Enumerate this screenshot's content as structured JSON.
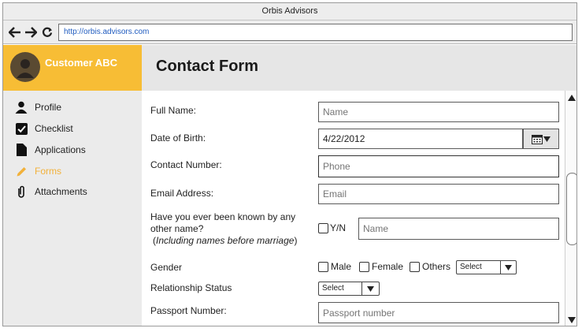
{
  "window": {
    "title": "Orbis Advisors"
  },
  "nav": {
    "url": "http://orbis.advisors.com"
  },
  "header": {
    "user_name": "Customer ABC",
    "page_title": "Contact Form"
  },
  "sidebar": {
    "items": [
      {
        "label": "Profile",
        "icon": "person-icon"
      },
      {
        "label": "Checklist",
        "icon": "checkbox-icon"
      },
      {
        "label": "Applications",
        "icon": "document-icon"
      },
      {
        "label": "Forms",
        "icon": "pencil-icon",
        "active": true
      },
      {
        "label": "Attachments",
        "icon": "paperclip-icon"
      }
    ]
  },
  "form": {
    "full_name": {
      "label": "Full Name:",
      "placeholder": "Name"
    },
    "dob": {
      "label": "Date of Birth:",
      "value": "4/22/2012"
    },
    "contact": {
      "label": "Contact Number:",
      "placeholder": "Phone"
    },
    "email": {
      "label": "Email Address:",
      "placeholder": "Email"
    },
    "other_name": {
      "label_line1": "Have you ever been known by any",
      "label_line2": "other name?",
      "label_note_prefix": "(",
      "label_note": "Including names before marriage",
      "label_note_suffix": ")",
      "checkbox_label": "Y/N",
      "placeholder": "Name"
    },
    "gender": {
      "label": "Gender",
      "options": [
        "Male",
        "Female",
        "Others"
      ],
      "select_value": "Select"
    },
    "relationship": {
      "label": "Relationship Status",
      "select_value": "Select"
    },
    "passport": {
      "label": "Passport Number:",
      "placeholder": "Passport number"
    }
  },
  "colors": {
    "accent": "#f7bd35",
    "active_nav": "#f2b13a",
    "link": "#1f5bbf"
  }
}
